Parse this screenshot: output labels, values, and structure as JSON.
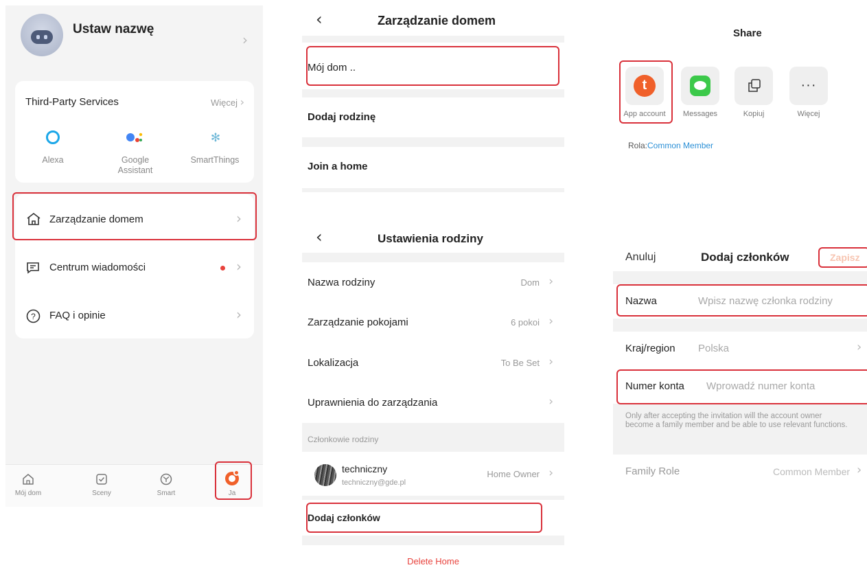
{
  "panel1": {
    "profile_name": "Ustaw nazwę",
    "third_party": {
      "title": "Third-Party Services",
      "more": "Więcej",
      "services": [
        {
          "label": "Alexa",
          "icon": "alexa-icon",
          "color": "#1ca7e8"
        },
        {
          "label": "Google\nAssistant",
          "icon": "google-assistant-icon"
        },
        {
          "label": "SmartThings",
          "icon": "smartthings-icon",
          "color": "#6fb8d8"
        }
      ]
    },
    "menu": [
      {
        "label": "Zarządzanie domem",
        "icon": "home-icon"
      },
      {
        "label": "Centrum wiadomości",
        "icon": "message-icon",
        "badge_color": "#e8423c"
      },
      {
        "label": "FAQ i opinie",
        "icon": "help-icon"
      }
    ],
    "tabs": [
      {
        "label": "Mój dom",
        "icon": "home-tab-icon"
      },
      {
        "label": "Sceny",
        "icon": "scenes-tab-icon"
      },
      {
        "label": "Smart",
        "icon": "smart-tab-icon"
      },
      {
        "label": "Ja",
        "icon": "me-tab-icon",
        "active": true
      }
    ]
  },
  "panel2": {
    "home_management": {
      "title": "Zarządzanie domem",
      "home_item": "Mój dom ..",
      "add_family": "Dodaj rodzinę",
      "join_home": "Join a home"
    },
    "family_settings": {
      "title": "Ustawienia rodziny",
      "rows": [
        {
          "label": "Nazwa rodziny",
          "value": "Dom"
        },
        {
          "label": "Zarządzanie pokojami",
          "value": "6 pokoi"
        },
        {
          "label": "Lokalizacja",
          "value": "To Be Set"
        },
        {
          "label": "Uprawnienia do zarządzania",
          "value": ""
        }
      ],
      "members_header": "Członkowie rodziny",
      "member": {
        "name": "techniczny",
        "email": "techniczny@gde.pl",
        "role": "Home Owner"
      },
      "add_member": "Dodaj członków",
      "delete_home": "Delete Home"
    }
  },
  "panel3": {
    "share": {
      "title": "Share",
      "targets": [
        {
          "label": "App account",
          "icon": "tuya-app-icon",
          "color": "#f0602a"
        },
        {
          "label": "Messages",
          "icon": "messages-icon",
          "color": "#3cc94a"
        },
        {
          "label": "Kopiuj",
          "icon": "copy-icon"
        },
        {
          "label": "Więcej",
          "icon": "more-icon"
        }
      ],
      "role_prefix": "Rola:",
      "role_value": "Common Member"
    },
    "add_members": {
      "cancel": "Anuluj",
      "title": "Dodaj członków",
      "save": "Zapisz",
      "name_label": "Nazwa",
      "name_placeholder": "Wpisz nazwę członka rodziny",
      "country_label": "Kraj/region",
      "country_value": "Polska",
      "account_label": "Numer konta",
      "account_placeholder": "Wprowadź numer konta",
      "note": "Only after accepting the invitation will the account owner become a family member and be able to use relevant functions.",
      "role_label": "Family Role",
      "role_value": "Common Member"
    }
  }
}
